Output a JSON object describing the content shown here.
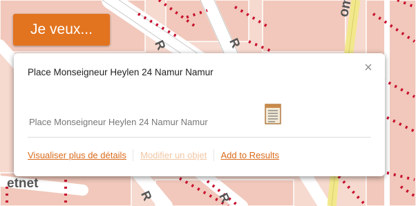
{
  "map": {
    "labels": {
      "top_right_street": "omel",
      "bottom_left_street": "etnet",
      "road_r1": "R",
      "road_r2": "R",
      "road_r3": "R",
      "road_r4": "R"
    }
  },
  "toolbar": {
    "je_veux_label": "Je veux..."
  },
  "popup": {
    "title": "Place Monseigneur Heylen 24 Namur Namur",
    "close_label": "×",
    "address": "Place Monseigneur Heylen 24 Namur Namur",
    "links": {
      "details": "Visualiser plus de détails",
      "edit": "Modifier un objet",
      "add": "Add to Results"
    }
  },
  "icons": {
    "close": "close-icon",
    "document": "document-icon"
  },
  "colors": {
    "accent": "#e2741f",
    "link": "#d96a1a",
    "link_disabled": "#f1c6a4",
    "map_background": "#f6d9cf",
    "road": "#ffffff",
    "road_highlight": "#f2e88b",
    "road_dots": "#c8102e"
  }
}
